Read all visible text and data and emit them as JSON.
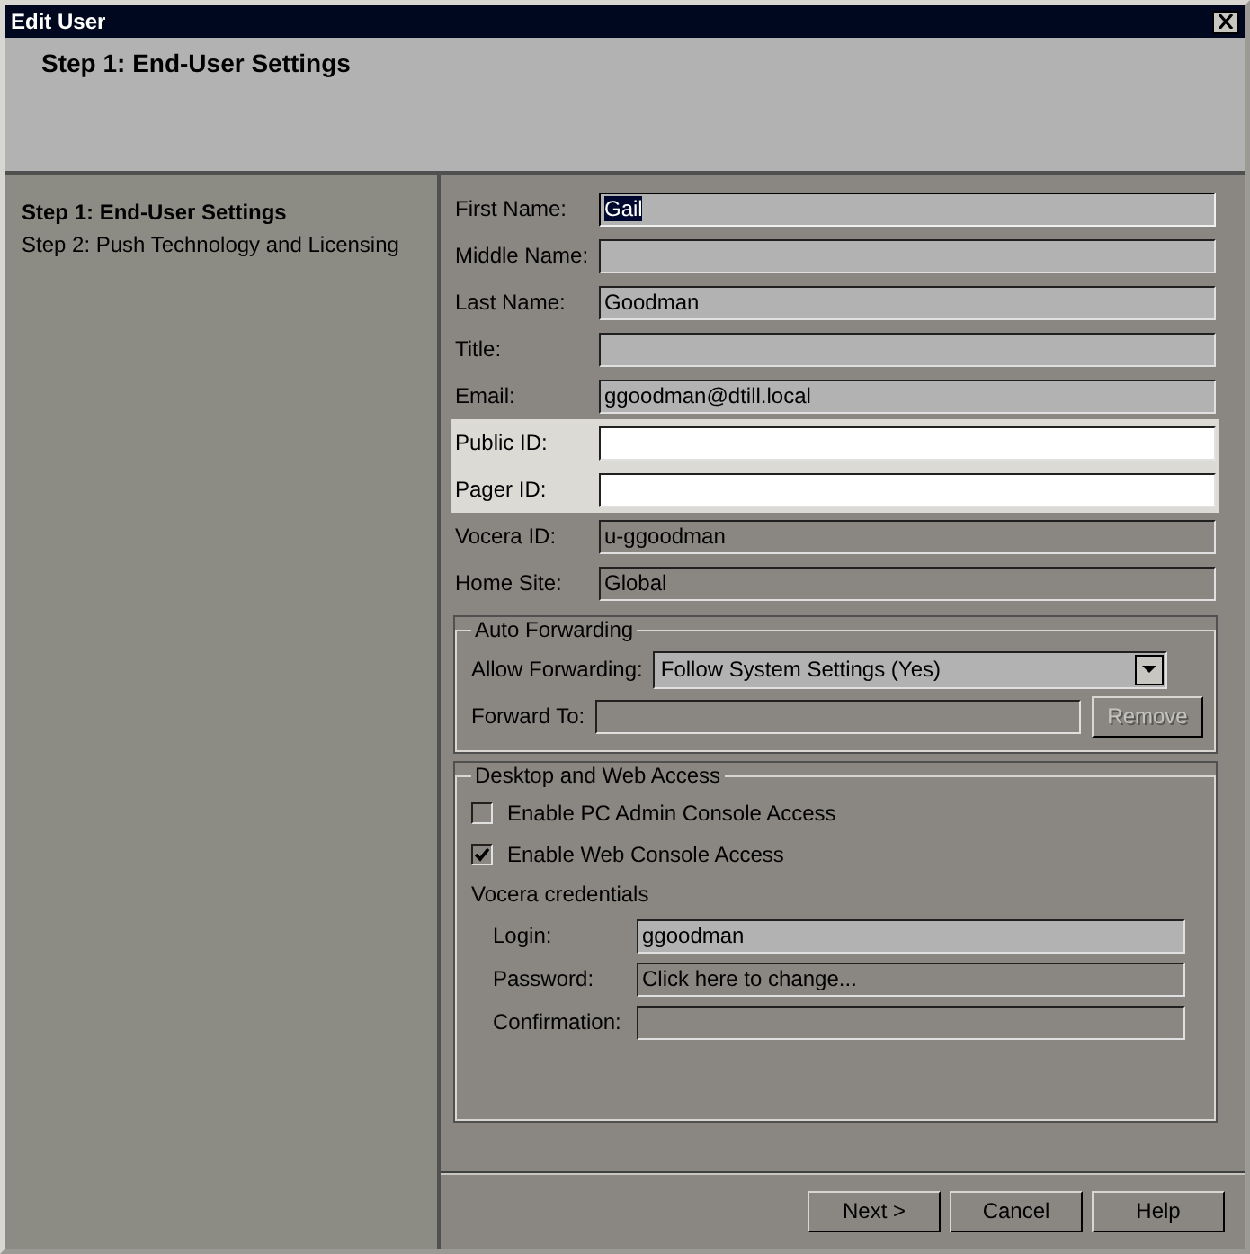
{
  "window": {
    "title": "Edit User"
  },
  "header": {
    "title": "Step 1: End-User Settings"
  },
  "sidebar": {
    "items": [
      {
        "label": "Step 1: End-User Settings",
        "selected": true
      },
      {
        "label": "Step 2: Push Technology and Licensing",
        "selected": false
      }
    ]
  },
  "fields": [
    {
      "label": "First Name:",
      "value": "Gail",
      "kind": "editable",
      "selected": true
    },
    {
      "label": "Middle Name:",
      "kind": "editable",
      "selected": false
    },
    {
      "label": "Last Name:",
      "value": "Goodman",
      "kind": "editable",
      "selected": false
    },
    {
      "label": "Title:",
      "kind": "editable",
      "selected": false
    },
    {
      "label": "Email:",
      "value": "ggoodman@dtill.local",
      "kind": "editable",
      "selected": false
    },
    {
      "label": "Public ID:",
      "kind": "highlighted",
      "selected": false
    },
    {
      "label": "Pager ID:",
      "kind": "highlighted",
      "selected": false
    },
    {
      "label": "Vocera ID:",
      "value": "u-ggoodman",
      "kind": "readonly",
      "selected": false
    },
    {
      "label": "Home Site:",
      "value": "Global",
      "kind": "readonly",
      "selected": false
    }
  ],
  "auto_forwarding": {
    "title": "Auto Forwarding",
    "allow_label": "Allow Forwarding:",
    "allow_value": "Follow System Settings (Yes)",
    "forward_label": "Forward To:",
    "forward_disabled": true,
    "remove_button": {
      "label": "Remove",
      "disabled": true
    }
  },
  "desktop_access": {
    "title": "Desktop and Web Access",
    "checkboxes": [
      {
        "label": "Enable PC Admin Console Access",
        "checked": false
      },
      {
        "label": "Enable Web Console Access",
        "checked": true
      }
    ],
    "credentials_title": "Vocera credentials",
    "credentials": [
      {
        "label": "Login:",
        "value": "ggoodman",
        "kind": "editable"
      },
      {
        "label": "Password:",
        "value": "Click here to change...",
        "kind": "readonly"
      },
      {
        "label": "Confirmation:",
        "kind": "readonly"
      }
    ]
  },
  "buttons": [
    "Next >",
    "Cancel",
    "Help"
  ]
}
